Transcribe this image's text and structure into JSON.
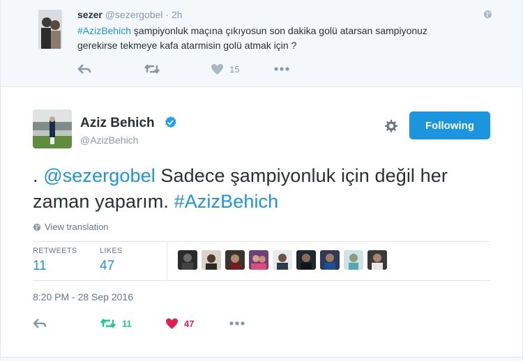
{
  "parent_tweet": {
    "name": "sezer",
    "handle": "@sezergobel",
    "dot": "·",
    "time": "2h",
    "hashtag": "#AzizBehich",
    "text": " şampiyonluk maçına çıkıyosun son dakika golü atarsan sampiyonuz gerekirse tekmeye kafa atarmisin golü atmak için ?",
    "likes": "15"
  },
  "main_tweet": {
    "name": "Aziz Behich",
    "handle": "@AzizBehich",
    "follow_label": "Following",
    "text_prefix": ". ",
    "mention": "@sezergobel",
    "text_body": " Sadece şampiyonluk için değil her zaman yaparım. ",
    "hashtag": "#AzizBehich",
    "translate_label": "View translation",
    "retweets_label": "RETWEETS",
    "retweets": "11",
    "likes_label": "LIKES",
    "likes": "47",
    "timestamp": "8:20 PM - 28 Sep 2016",
    "action_retweets": "11",
    "action_likes": "47"
  },
  "colors": {
    "accent": "#1b95e0",
    "retweet": "#19cf86",
    "like": "#e81c4f",
    "muted": "#8899a6"
  },
  "likers": [
    "avatar-1",
    "avatar-2",
    "avatar-3",
    "avatar-4",
    "avatar-5",
    "avatar-6",
    "avatar-7",
    "avatar-8",
    "avatar-9"
  ]
}
